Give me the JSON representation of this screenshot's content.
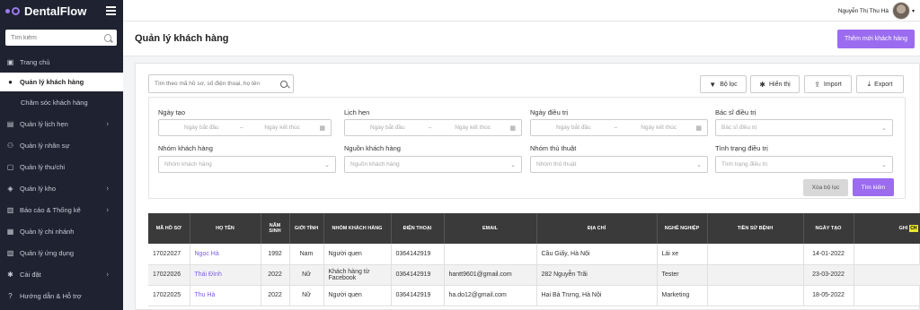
{
  "app": {
    "name": "DentalFlow"
  },
  "sidebar": {
    "search_placeholder": "Tìm kiếm",
    "items": [
      {
        "label": "Trang chủ",
        "icon": "dashboard-icon"
      },
      {
        "label": "Quản lý khách hàng",
        "icon": "user-icon"
      },
      {
        "label": "Chăm sóc khách hàng",
        "icon": ""
      },
      {
        "label": "Quản lý lịch hẹn",
        "icon": "calendar-icon"
      },
      {
        "label": "Quản lý nhân sự",
        "icon": "users-icon"
      },
      {
        "label": "Quản lý thu/chi",
        "icon": "wallet-icon"
      },
      {
        "label": "Quản lý kho",
        "icon": "box-icon"
      },
      {
        "label": "Báo cáo & Thống kê",
        "icon": "chart-icon"
      },
      {
        "label": "Quản lý chi nhánh",
        "icon": "branch-icon"
      },
      {
        "label": "Quản lý ứng dụng",
        "icon": "app-icon"
      },
      {
        "label": "Cài đặt",
        "icon": "gear-icon"
      },
      {
        "label": "Hướng dẫn & Hỗ trợ",
        "icon": "help-icon"
      }
    ]
  },
  "topbar": {
    "user_name": "Nguyễn Thị Thu Hà"
  },
  "header": {
    "title": "Quản lý khách hàng",
    "add_button": "Thêm mới khách hàng"
  },
  "toolbar": {
    "search_placeholder": "Tìm theo mã hồ sơ, số điện thoại, họ tên",
    "filter": "Bộ lọc",
    "display": "Hiển thị",
    "import": "Import",
    "export": "Export"
  },
  "filters": {
    "ngay_tao": {
      "label": "Ngày tạo",
      "start": "Ngày bắt đầu",
      "end": "Ngày kết thúc"
    },
    "lich_hen": {
      "label": "Lịch hẹn",
      "start": "Ngày bắt đầu",
      "end": "Ngày kết thúc"
    },
    "ngay_dieu_tri": {
      "label": "Ngày điều trị",
      "start": "Ngày bắt đầu",
      "end": "Ngày kết thúc"
    },
    "bac_si": {
      "label": "Bác sĩ điều trị",
      "placeholder": "Bác sĩ điều trị"
    },
    "nhom_kh": {
      "label": "Nhóm khách hàng",
      "placeholder": "Nhóm khách hàng"
    },
    "nguon_kh": {
      "label": "Nguồn khách hàng",
      "placeholder": "Nguồn khách hàng"
    },
    "nhom_tt": {
      "label": "Nhóm thủ thuật",
      "placeholder": "Nhóm thủ thuật"
    },
    "tinh_trang": {
      "label": "Tình trạng điều trị",
      "placeholder": "Tình trạng điều trị"
    },
    "reset": "Xóa bộ lọc",
    "search": "Tìm kiếm"
  },
  "table": {
    "headers": [
      "MÃ HỒ SƠ",
      "HỌ TÊN",
      "NĂM SINH",
      "GIỚI TÍNH",
      "NHÓM KHÁCH HÀNG",
      "ĐIỆN THOẠI",
      "EMAIL",
      "ĐỊA CHỈ",
      "NGHỀ NGHIỆP",
      "TIỀN SỬ BỆNH",
      "NGÀY TẠO",
      "GHI"
    ],
    "scroll_tag": "CH",
    "rows": [
      [
        "17022027",
        "Ngọc Hà",
        "1992",
        "Nam",
        "Người quen",
        "0364142919",
        "",
        "Cầu Giấy, Hà Nội",
        "Lái xe",
        "",
        "14-01-2022",
        ""
      ],
      [
        "17022026",
        "Thái Đình",
        "2022",
        "Nữ",
        "Khách hàng từ Facebook",
        "0364142919",
        "hantt9601@gmail.com",
        "282 Nguyễn Trãi",
        "Tester",
        "",
        "23-03-2022",
        ""
      ],
      [
        "17022025",
        "Thu Hà",
        "2022",
        "Nữ",
        "Người quen",
        "0364142919",
        "ha.do12@gmail.com",
        "Hai Bà Trưng, Hà Nội",
        "Marketing",
        "",
        "18-05-2022",
        ""
      ]
    ]
  },
  "colors": {
    "accent": "#9b6cf0",
    "sidebar_bg": "#1f2230",
    "table_head": "#3a3a3a",
    "link": "#7b5ce5"
  }
}
